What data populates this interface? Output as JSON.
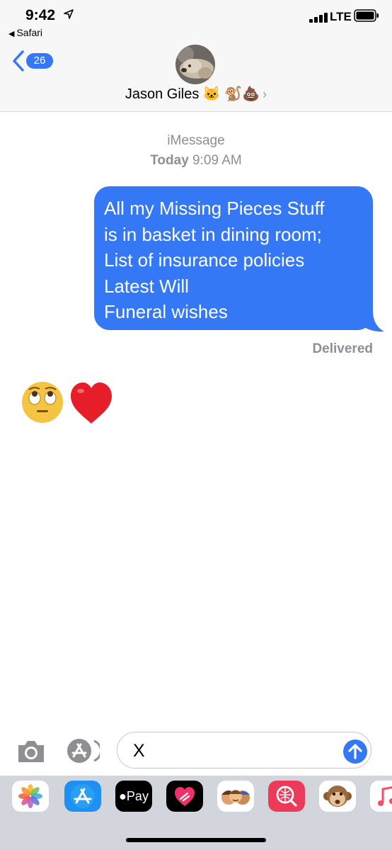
{
  "status_bar": {
    "time": "9:42",
    "back_app": "Safari",
    "network": "LTE"
  },
  "header": {
    "back_badge": "26",
    "contact_name": "Jason Giles 🐱 🐒💩",
    "contact_chevron": "›"
  },
  "conversation": {
    "service": "iMessage",
    "timestamp_day": "Today",
    "timestamp_time": "9:09 AM",
    "messages": [
      {
        "direction": "outgoing",
        "text": "All my Missing Pieces Stuff\nis in basket in dining room;\nList of insurance policies\nLatest Will\nFuneral wishes",
        "status": "Delivered"
      },
      {
        "direction": "incoming",
        "emojis": [
          "face-with-rolling-eyes",
          "red-heart"
        ]
      }
    ]
  },
  "composer": {
    "value": "X"
  },
  "app_tray": {
    "apps": [
      "photos-icon",
      "app-store-icon",
      "apple-pay-icon",
      "digital-touch-icon",
      "memoji-icon",
      "web-images-icon",
      "animoji-monkey-icon",
      "music-icon"
    ],
    "apple_pay_label": "Pay"
  },
  "colors": {
    "bubble_blue": "#3478f6",
    "meta_gray": "#8e8e93",
    "tray_gray": "#d2d5db"
  }
}
